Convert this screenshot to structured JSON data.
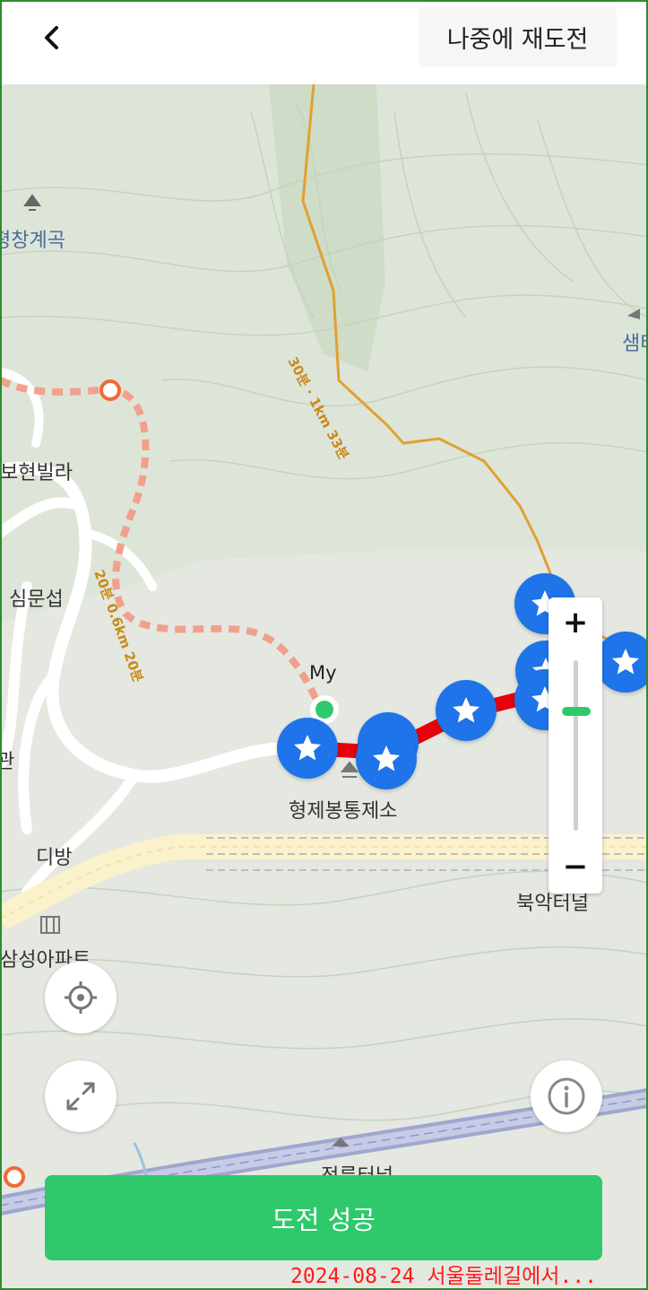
{
  "header": {
    "back_icon": "chevron-left-icon",
    "retry_label": "나중에 재도전"
  },
  "map": {
    "labels": {
      "valley": "평창계곡",
      "villa": "보현빌라",
      "simmunseop": "심문섭",
      "dibang": "디방",
      "apartment": "삼성아파트",
      "checkpoint": "형제봉통제소",
      "left_edge": "관",
      "right_top": "샘터",
      "terminal": "북악터널",
      "tunnel": "정릉터널"
    },
    "trail_labels": {
      "orange_a": "30분 · 1km 33분",
      "dashed_a": "20분 0.6km 20분"
    },
    "my_label": "My",
    "stamp_icon": "star-icon",
    "stamp_color": "#1e74e8",
    "route_color": "#e8000b",
    "zoom": {
      "plus": "+",
      "minus": "−",
      "level": 0.71
    },
    "locate_icon": "crosshair-icon",
    "expand_icon": "expand-icon",
    "info_icon": "info-icon"
  },
  "footer": {
    "success_label": "도전 성공",
    "success_color": "#2fc96b"
  },
  "caption": "2024-08-24 서울둘레길에서..."
}
